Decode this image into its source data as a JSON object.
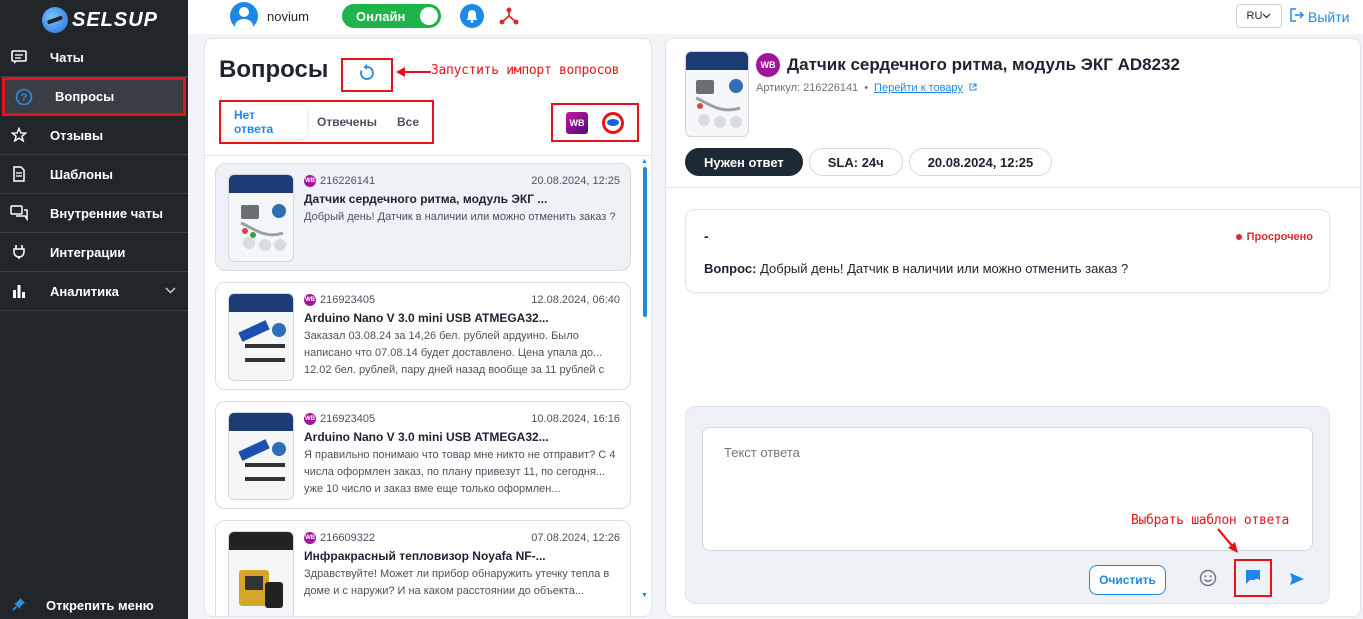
{
  "brand": {
    "name": "SELSUP"
  },
  "sidebar": {
    "items": [
      {
        "label": "Чаты",
        "icon": "chat-icon"
      },
      {
        "label": "Вопросы",
        "icon": "question-icon",
        "active": true
      },
      {
        "label": "Отзывы",
        "icon": "star-icon"
      },
      {
        "label": "Шаблоны",
        "icon": "document-icon"
      },
      {
        "label": "Внутренние чаты",
        "icon": "internal-chats-icon"
      },
      {
        "label": "Интеграции",
        "icon": "plug-icon"
      },
      {
        "label": "Аналитика",
        "icon": "bar-chart-icon",
        "expandable": true
      }
    ],
    "pin_label": "Открепить меню"
  },
  "topbar": {
    "username": "novium",
    "status_toggle": "Онлайн",
    "status_on": true,
    "language": "RU",
    "logout": "Выйти"
  },
  "questions": {
    "title": "Вопросы",
    "refresh_annotation": "Запустить импорт вопросов",
    "tabs": [
      {
        "label": "Нет ответа",
        "active": true
      },
      {
        "label": "Отвечены"
      },
      {
        "label": "Все"
      }
    ],
    "marketplaces": [
      "WB",
      "Ozon"
    ],
    "items": [
      {
        "marketplace": "WB",
        "sku": "216226141",
        "date": "20.08.2024, 12:25",
        "title": "Датчик сердечного ритма, модуль ЭКГ ...",
        "text": "Добрый день! Датчик в наличии или можно отменить заказ ?",
        "selected": true
      },
      {
        "marketplace": "WB",
        "sku": "216923405",
        "date": "12.08.2024, 06:40",
        "title": "Arduino Nano V 3.0 mini USB ATMEGA32...",
        "text": "Заказал 03.08.24 за 14,26 бел. рублей ардуино. Было написано что 07.08.14 будет доставлено. Цена упала до... 12.02 бел. рублей, пару дней назад вообще за 11 рублей с"
      },
      {
        "marketplace": "WB",
        "sku": "216923405",
        "date": "10.08.2024, 16:16",
        "title": "Arduino Nano V 3.0 mini USB ATMEGA32...",
        "text": "Я правильно понимаю что товар мне никто не отправит? С 4 числа оформлен заказ, по плану привезут 11, по сегодня... уже 10 число и заказ вме еще только оформлен..."
      },
      {
        "marketplace": "WB",
        "sku": "216609322",
        "date": "07.08.2024, 12:26",
        "title": "Инфракрасный тепловизор Noyafa NF-...",
        "text": "Здравствуйте! Может ли прибор обнаружить утечку тепла в доме и с наружи? И на каком расстоянии до объекта..."
      }
    ]
  },
  "detail": {
    "marketplace": "WB",
    "title": "Датчик сердечного ритма, модуль ЭКГ AD8232",
    "sku_label": "Артикул: 216226141",
    "product_link": "Перейти к товару",
    "chips": [
      "Нужен ответ",
      "SLA: 24ч",
      "20.08.2024, 12:25"
    ],
    "question_author": "-",
    "question_status": "Просрочено",
    "question_prefix": "Вопрос:",
    "question_text": " Добрый день! Датчик в наличии или можно отменить заказ ?",
    "reply_placeholder": "Текст ответа",
    "clear_label": "Очистить",
    "template_annotation": "Выбрать шаблон ответа"
  },
  "colors": {
    "accent": "#1e88e5",
    "annotation": "#e3151b",
    "sidebar": "#22262b",
    "online": "#1fb34b"
  }
}
